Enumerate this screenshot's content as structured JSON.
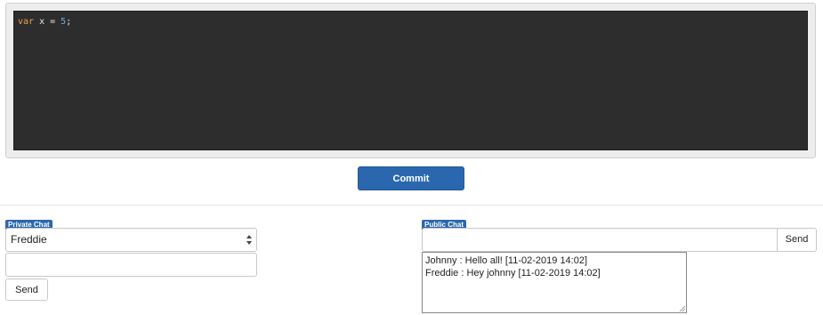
{
  "editor": {
    "code": {
      "keyword": "var",
      "middle": " x = ",
      "number": "5",
      "end": ";"
    }
  },
  "commit": {
    "label": "Commit"
  },
  "private_chat": {
    "badge": "Private Chat",
    "selected_user": "Freddie",
    "message_value": "",
    "send_label": "Send"
  },
  "public_chat": {
    "badge": "Public Chat",
    "message_value": "",
    "send_label": "Send",
    "messages": [
      {
        "text": "Johnny : Hello all! [11-02-2019 14:02]"
      },
      {
        "text": "Freddie : Hey johnny [11-02-2019 14:02]"
      }
    ]
  },
  "colors": {
    "accent": "#2b67ae",
    "editor_bg": "#2d2d2d",
    "keyword": "#f0a24f",
    "number": "#6ab0de"
  }
}
